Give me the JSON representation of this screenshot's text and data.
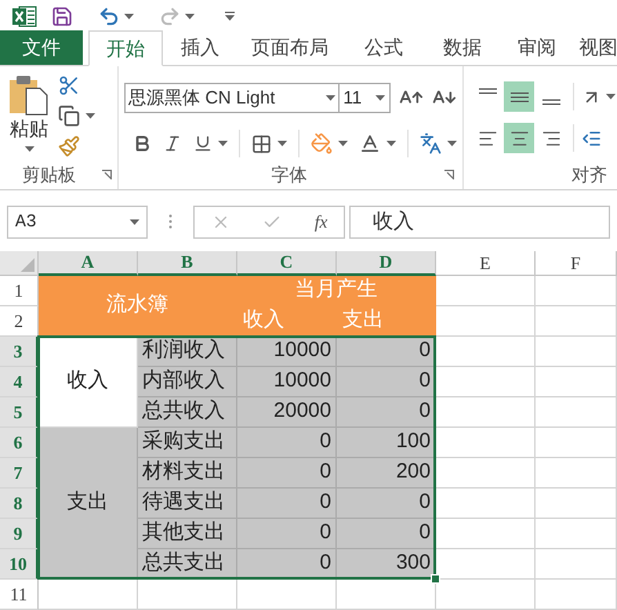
{
  "tabs": [
    {
      "label": "文件",
      "kind": "file",
      "selected": false
    },
    {
      "label": "开始",
      "kind": "tab",
      "selected": true
    },
    {
      "label": "插入",
      "kind": "tab",
      "selected": false
    },
    {
      "label": "页面布局",
      "kind": "tab",
      "selected": false
    },
    {
      "label": "公式",
      "kind": "tab",
      "selected": false
    },
    {
      "label": "数据",
      "kind": "tab",
      "selected": false
    },
    {
      "label": "审阅",
      "kind": "tab",
      "selected": false
    },
    {
      "label": "视图",
      "kind": "tab",
      "selected": false
    }
  ],
  "ribbon": {
    "paste_label": "粘贴",
    "font_name": "思源黑体 CN Light",
    "font_size": "11",
    "vertical_align": [
      {
        "selected": false
      },
      {
        "selected": true
      },
      {
        "selected": false
      }
    ],
    "horizontal_align": [
      {
        "selected": false
      },
      {
        "selected": true
      },
      {
        "selected": false
      }
    ],
    "groups": [
      {
        "label": "剪贴板"
      },
      {
        "label": "字体"
      },
      {
        "label": "对齐"
      }
    ]
  },
  "formula_bar": {
    "name_box": "A3",
    "function_label": "fx",
    "formula": "收入"
  },
  "sheet": {
    "columns": [
      {
        "label": "A",
        "selected": true
      },
      {
        "label": "B",
        "selected": true
      },
      {
        "label": "C",
        "selected": true
      },
      {
        "label": "D",
        "selected": true
      },
      {
        "label": "E",
        "selected": false
      },
      {
        "label": "F",
        "selected": false
      }
    ],
    "rows": [
      {
        "label": "1",
        "selected": false,
        "cells": [
          {
            "kind": "title",
            "text": "流水簿"
          },
          {
            "kind": "merge-left"
          },
          {
            "kind": "title",
            "text": "当月产生"
          },
          {
            "kind": "merge-left"
          }
        ]
      },
      {
        "label": "2",
        "selected": false,
        "cells": [
          {
            "kind": "merge-up"
          },
          {
            "kind": "merge-up"
          },
          {
            "kind": "subheading",
            "text": "收入"
          },
          {
            "kind": "subheading",
            "text": "支出"
          }
        ]
      },
      {
        "label": "3",
        "selected": true,
        "cells": [
          {
            "kind": "merge-down"
          },
          {
            "kind": "label",
            "text": "利润收入"
          },
          {
            "kind": "number",
            "text": "10000"
          },
          {
            "kind": "number",
            "text": "0"
          }
        ]
      },
      {
        "label": "4",
        "selected": true,
        "cells": [
          {
            "kind": "group",
            "text": "收入",
            "active": true
          },
          {
            "kind": "label",
            "text": "内部收入"
          },
          {
            "kind": "number",
            "text": "10000"
          },
          {
            "kind": "number",
            "text": "0"
          }
        ]
      },
      {
        "label": "5",
        "selected": true,
        "cells": [
          {
            "kind": "merge-up"
          },
          {
            "kind": "label",
            "text": "总共收入"
          },
          {
            "kind": "number",
            "text": "20000"
          },
          {
            "kind": "number",
            "text": "0"
          }
        ]
      },
      {
        "label": "6",
        "selected": true,
        "cells": [
          {
            "kind": "merge-down"
          },
          {
            "kind": "label",
            "text": "采购支出"
          },
          {
            "kind": "number",
            "text": "0"
          },
          {
            "kind": "number",
            "text": "100"
          }
        ]
      },
      {
        "label": "7",
        "selected": true,
        "cells": [
          {
            "kind": "merge-down"
          },
          {
            "kind": "label",
            "text": "材料支出"
          },
          {
            "kind": "number",
            "text": "0"
          },
          {
            "kind": "number",
            "text": "200"
          }
        ]
      },
      {
        "label": "8",
        "selected": true,
        "cells": [
          {
            "kind": "group",
            "text": "支出",
            "active": false
          },
          {
            "kind": "label",
            "text": "待遇支出"
          },
          {
            "kind": "number",
            "text": "0"
          },
          {
            "kind": "number",
            "text": "0"
          }
        ]
      },
      {
        "label": "9",
        "selected": true,
        "cells": [
          {
            "kind": "merge-up"
          },
          {
            "kind": "label",
            "text": "其他支出"
          },
          {
            "kind": "number",
            "text": "0"
          },
          {
            "kind": "number",
            "text": "0"
          }
        ]
      },
      {
        "label": "10",
        "selected": true,
        "cells": [
          {
            "kind": "merge-up"
          },
          {
            "kind": "label",
            "text": "总共支出"
          },
          {
            "kind": "number",
            "text": "0"
          },
          {
            "kind": "number",
            "text": "300"
          }
        ]
      },
      {
        "label": "11",
        "selected": false,
        "cells": []
      }
    ]
  }
}
